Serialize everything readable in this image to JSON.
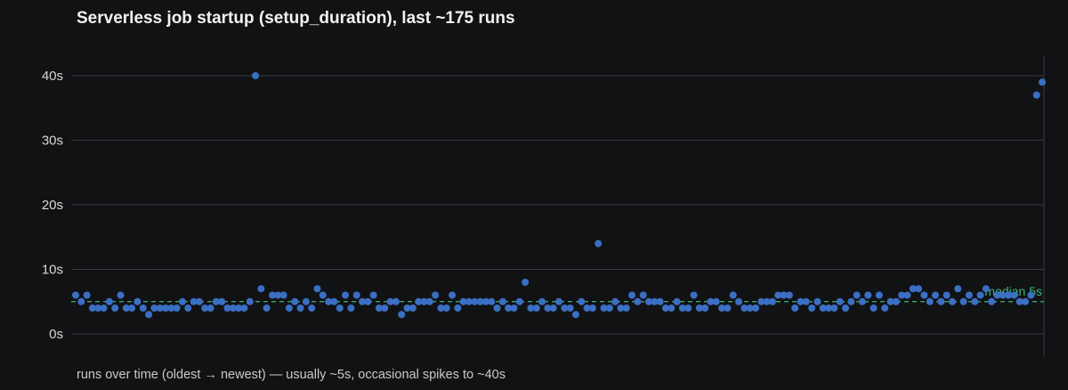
{
  "colors": {
    "background": "#111214",
    "grid": "#3a3b3f",
    "point": "#3b6fc4",
    "median": "#41b37a"
  },
  "chart_data": {
    "type": "scatter",
    "title": "Serverless job startup (setup_duration), last ~175 runs",
    "xlabel": "runs over time (oldest → newest) — usually ~5s, occasional spikes to ~40s",
    "ylabel": "",
    "ylim": [
      0,
      40
    ],
    "yticks": [
      0,
      10,
      20,
      30,
      40
    ],
    "ytick_labels": [
      "0s",
      "10s",
      "20s",
      "30s",
      "40s"
    ],
    "grid": true,
    "median": {
      "value": 5,
      "label": "median 5s"
    },
    "series": [
      {
        "values": [
          6,
          5,
          6,
          4,
          4,
          4,
          5,
          4,
          6,
          4,
          4,
          5,
          4,
          3,
          4,
          4,
          4,
          4,
          4,
          5,
          4,
          5,
          5,
          4,
          4,
          5,
          5,
          4,
          4,
          4,
          4,
          5,
          40,
          7,
          4,
          6,
          6,
          6,
          4,
          5,
          4,
          5,
          4,
          7,
          6,
          5,
          5,
          4,
          6,
          4,
          6,
          5,
          5,
          6,
          4,
          4,
          5,
          5,
          3,
          4,
          4,
          5,
          5,
          5,
          6,
          4,
          4,
          6,
          4,
          5,
          5,
          5,
          5,
          5,
          5,
          4,
          5,
          4,
          4,
          5,
          8,
          4,
          4,
          5,
          4,
          4,
          5,
          4,
          4,
          3,
          5,
          4,
          4,
          14,
          4,
          4,
          5,
          4,
          4,
          6,
          5,
          6,
          5,
          5,
          5,
          4,
          4,
          5,
          4,
          4,
          6,
          4,
          4,
          5,
          5,
          4,
          4,
          6,
          5,
          4,
          4,
          4,
          5,
          5,
          5,
          6,
          6,
          6,
          4,
          5,
          5,
          4,
          5,
          4,
          4,
          4,
          5,
          4,
          5,
          6,
          5,
          6,
          4,
          6,
          4,
          5,
          5,
          6,
          6,
          7,
          7,
          6,
          5,
          6,
          5,
          6,
          5,
          7,
          5,
          6,
          5,
          6,
          7,
          5,
          6,
          6,
          6,
          6,
          5,
          5,
          6,
          37,
          39
        ]
      }
    ]
  }
}
